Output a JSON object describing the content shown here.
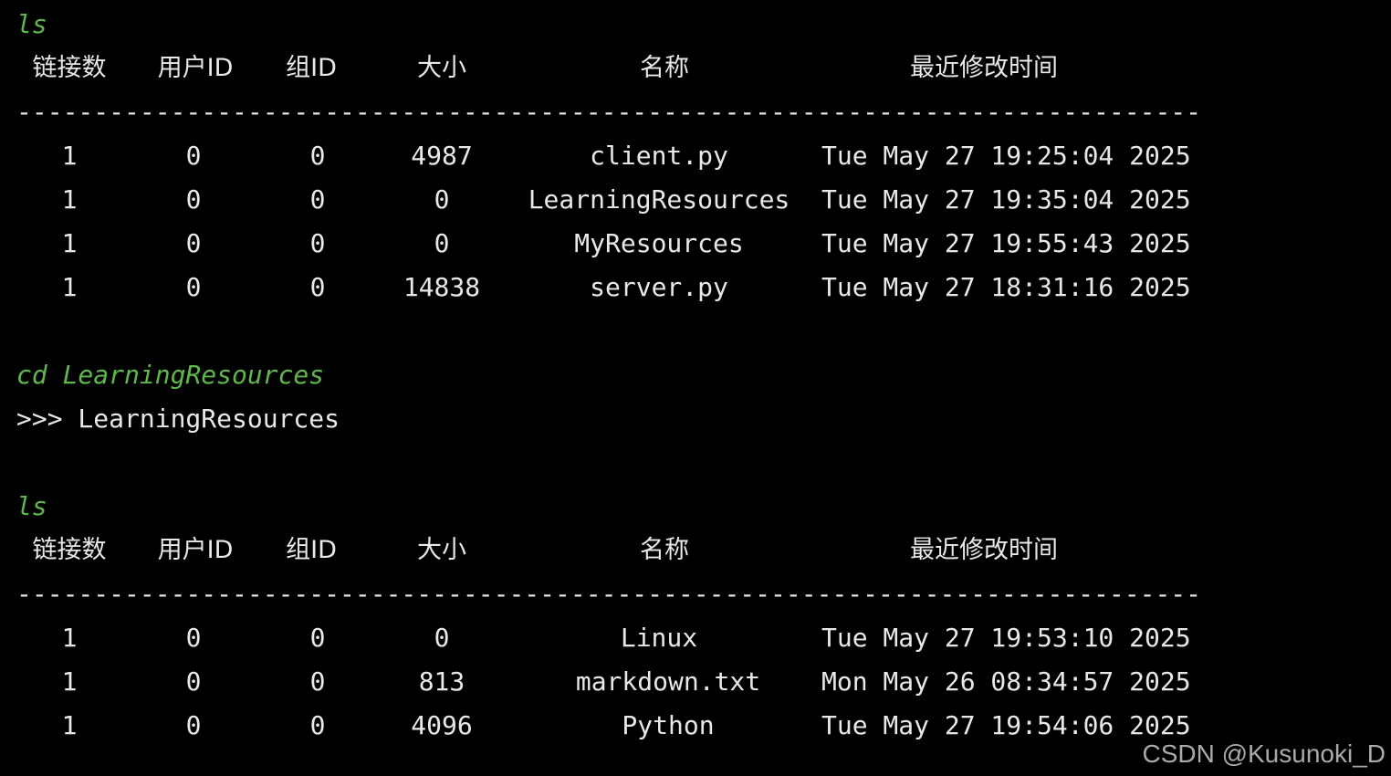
{
  "terminal": {
    "blocks": [
      {
        "command": "ls",
        "headers": [
          "链接数",
          "用户ID",
          "组ID",
          "大小",
          "名称",
          "最近修改时间"
        ],
        "separator": "-----------------------------------------------------------------------------",
        "rows": [
          [
            "1",
            "0",
            "0",
            "4987",
            "client.py",
            "Tue May 27 19:25:04 2025"
          ],
          [
            "1",
            "0",
            "0",
            "0",
            "LearningResources",
            "Tue May 27 19:35:04 2025"
          ],
          [
            "1",
            "0",
            "0",
            "0",
            "MyResources",
            "Tue May 27 19:55:43 2025"
          ],
          [
            "1",
            "0",
            "0",
            "14838",
            "server.py",
            "Tue May 27 18:31:16 2025"
          ]
        ]
      },
      {
        "command": "cd LearningResources",
        "output": ">>> LearningResources"
      },
      {
        "command": "ls",
        "headers": [
          "链接数",
          "用户ID",
          "组ID",
          "大小",
          "名称",
          "最近修改时间"
        ],
        "separator": "-----------------------------------------------------------------------------",
        "rows": [
          [
            "1",
            "0",
            "0",
            "0",
            "Linux",
            "Tue May 27 19:53:10 2025"
          ],
          [
            "1",
            "0",
            "0",
            "813",
            "markdown.txt",
            "Mon May 26 08:34:57 2025"
          ],
          [
            "1",
            "0",
            "0",
            "4096",
            "Python",
            "Tue May 27 19:54:06 2025"
          ]
        ]
      }
    ]
  },
  "watermark": "CSDN @Kusunoki_D",
  "colors": {
    "background": "#000000",
    "command": "#5fb84a",
    "text": "#e8e8e8"
  }
}
